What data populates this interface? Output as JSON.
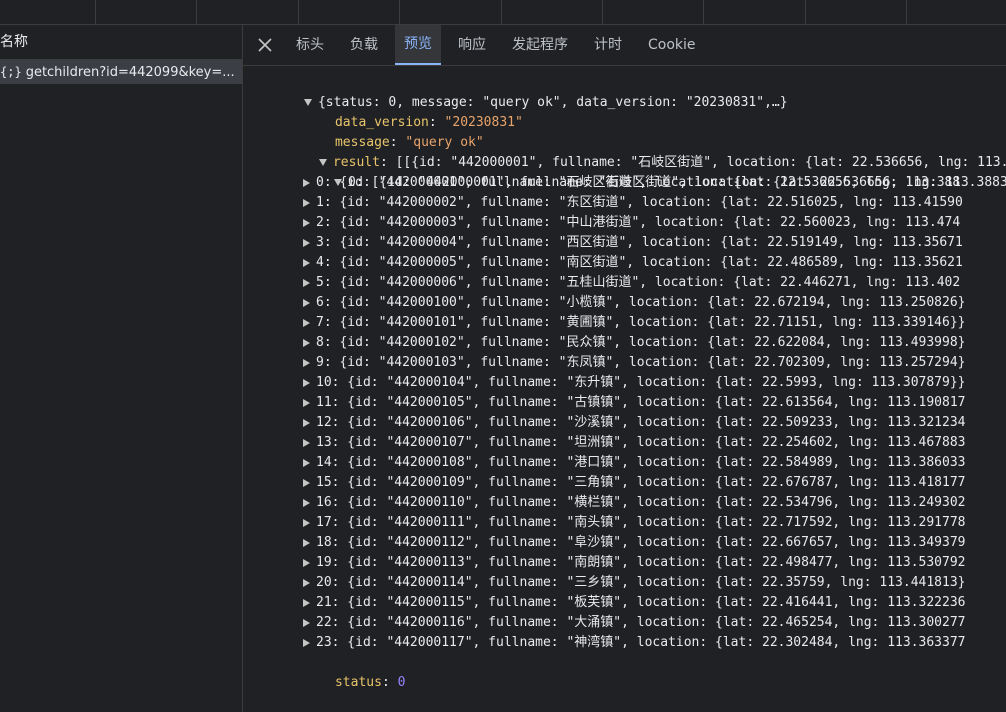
{
  "left": {
    "header": "名称",
    "request_icon": "{;}",
    "request_name": "getchildren?id=442099&key=..."
  },
  "tabs": [
    "标头",
    "负载",
    "预览",
    "响应",
    "发起程序",
    "计时",
    "Cookie"
  ],
  "active_tab": "预览",
  "preview": {
    "root_summary": "{status: 0, message: \"query ok\", data_version: \"20230831\",…}",
    "data_version_key": "data_version",
    "data_version_value": "\"20230831\"",
    "message_key": "message",
    "message_value": "\"query ok\"",
    "result_key": "result",
    "result_summary": "[[{id: \"442000001\", fullname: \"石岐区街道\", location: {lat: 22.536656, lng: 113.",
    "group0_summary": "0: [{id: \"442000001\", fullname: \"石岐区街道\", location: {lat: 22.536656, lng: 113.3883",
    "items": [
      "0: {id: \"442000001\", fullname: \"石岐区街道\", location: {lat: 22.536656, lng: 113.388",
      "1: {id: \"442000002\", fullname: \"东区街道\", location: {lat: 22.516025, lng: 113.41590",
      "2: {id: \"442000003\", fullname: \"中山港街道\", location: {lat: 22.560023, lng: 113.474",
      "3: {id: \"442000004\", fullname: \"西区街道\", location: {lat: 22.519149, lng: 113.35671",
      "4: {id: \"442000005\", fullname: \"南区街道\", location: {lat: 22.486589, lng: 113.35621",
      "5: {id: \"442000006\", fullname: \"五桂山街道\", location: {lat: 22.446271, lng: 113.402",
      "6: {id: \"442000100\", fullname: \"小榄镇\", location: {lat: 22.672194, lng: 113.250826}",
      "7: {id: \"442000101\", fullname: \"黄圃镇\", location: {lat: 22.71151, lng: 113.339146}}",
      "8: {id: \"442000102\", fullname: \"民众镇\", location: {lat: 22.622084, lng: 113.493998}",
      "9: {id: \"442000103\", fullname: \"东凤镇\", location: {lat: 22.702309, lng: 113.257294}",
      "10: {id: \"442000104\", fullname: \"东升镇\", location: {lat: 22.5993, lng: 113.307879}}",
      "11: {id: \"442000105\", fullname: \"古镇镇\", location: {lat: 22.613564, lng: 113.190817",
      "12: {id: \"442000106\", fullname: \"沙溪镇\", location: {lat: 22.509233, lng: 113.321234",
      "13: {id: \"442000107\", fullname: \"坦洲镇\", location: {lat: 22.254602, lng: 113.467883",
      "14: {id: \"442000108\", fullname: \"港口镇\", location: {lat: 22.584989, lng: 113.386033",
      "15: {id: \"442000109\", fullname: \"三角镇\", location: {lat: 22.676787, lng: 113.418177",
      "16: {id: \"442000110\", fullname: \"横栏镇\", location: {lat: 22.534796, lng: 113.249302",
      "17: {id: \"442000111\", fullname: \"南头镇\", location: {lat: 22.717592, lng: 113.291778",
      "18: {id: \"442000112\", fullname: \"阜沙镇\", location: {lat: 22.667657, lng: 113.349379",
      "19: {id: \"442000113\", fullname: \"南朗镇\", location: {lat: 22.498477, lng: 113.530792",
      "20: {id: \"442000114\", fullname: \"三乡镇\", location: {lat: 22.35759, lng: 113.441813}",
      "21: {id: \"442000115\", fullname: \"板芙镇\", location: {lat: 22.416441, lng: 113.322236",
      "22: {id: \"442000116\", fullname: \"大涌镇\", location: {lat: 22.465254, lng: 113.300277",
      "23: {id: \"442000117\", fullname: \"神湾镇\", location: {lat: 22.302484, lng: 113.363377"
    ],
    "status_key": "status",
    "status_value": "0"
  }
}
